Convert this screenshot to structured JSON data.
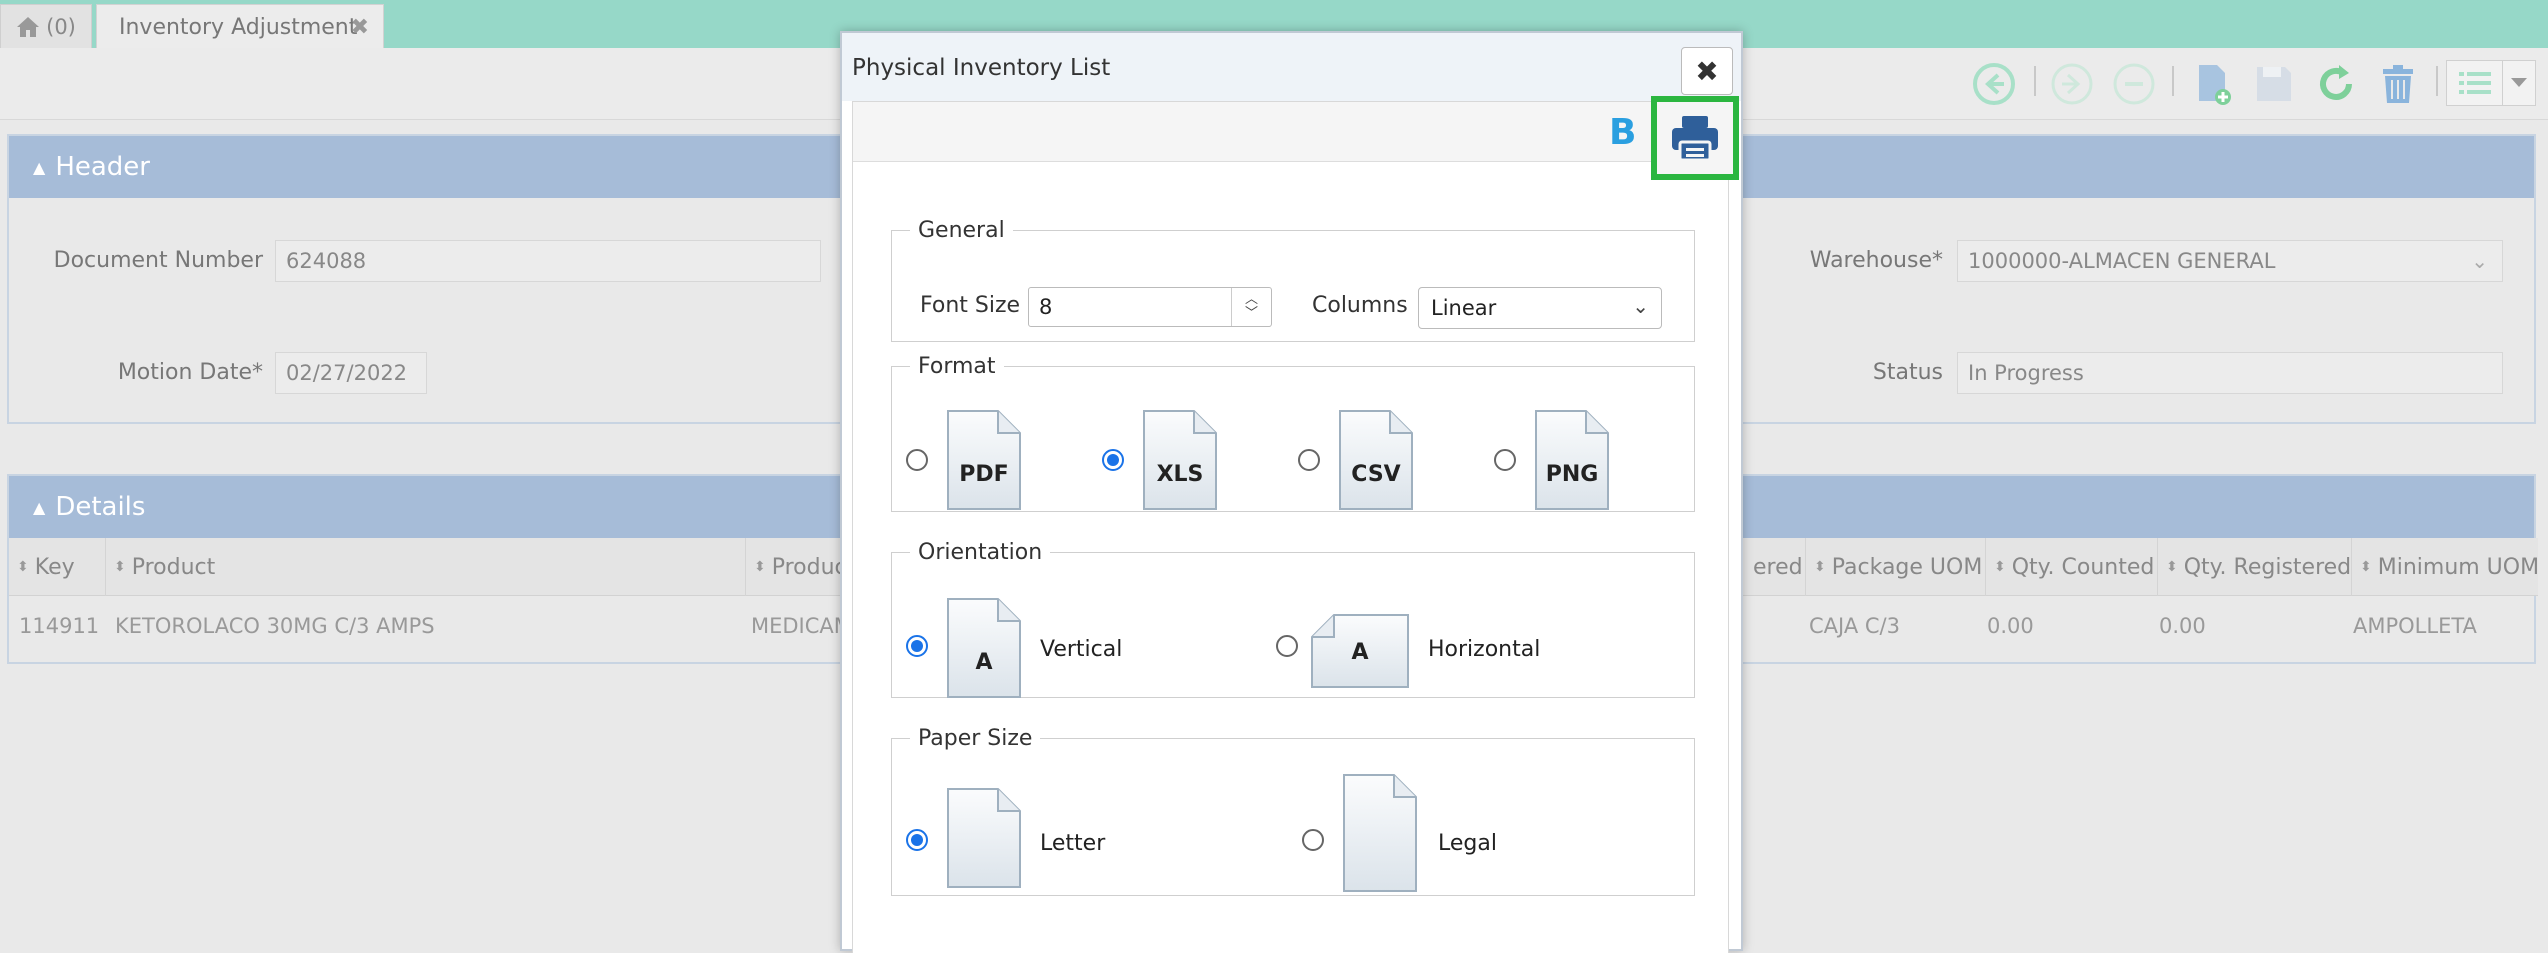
{
  "tabs": {
    "home_count": "(0)",
    "active_label": "Inventory Adjustment",
    "close_glyph": "✖"
  },
  "header_panel": {
    "title": "Header",
    "fields": {
      "document_number_label": "Document Number",
      "document_number_value": "624088",
      "motion_date_label": "Motion Date*",
      "motion_date_value": "02/27/2022",
      "warehouse_label": "Warehouse*",
      "warehouse_value": "1000000-ALMACEN GENERAL",
      "status_label": "Status",
      "status_value": "In Progress"
    }
  },
  "details_panel": {
    "title": "Details",
    "columns": [
      "Key",
      "Product",
      "Produc",
      "ered",
      "Package UOM",
      "Qty. Counted",
      "Qty. Registered",
      "Minimum UOM"
    ],
    "rows": [
      [
        "114911",
        "KETOROLACO 30MG C/3 AMPS",
        "MEDICAM",
        "",
        "CAJA C/3",
        "0.00",
        "0.00",
        "AMPOLLETA"
      ]
    ]
  },
  "toolbar_icons": [
    "back-arrow-icon",
    "forward-arrow-icon",
    "cancel-icon",
    "new-document-icon",
    "save-icon",
    "refresh-icon",
    "trash-icon",
    "list-icon",
    "chevron-down-icon"
  ],
  "modal": {
    "title": "Physical Inventory List",
    "close_glyph": "✖",
    "toolbar_b": "B",
    "general": {
      "legend": "General",
      "font_size_label": "Font Size",
      "font_size_value": "8",
      "columns_label": "Columns",
      "columns_value": "Linear"
    },
    "format": {
      "legend": "Format",
      "options": [
        "PDF",
        "XLS",
        "CSV",
        "PNG"
      ],
      "selected": "XLS"
    },
    "orientation": {
      "legend": "Orientation",
      "vertical_label": "Vertical",
      "horizontal_label": "Horizontal",
      "icon_letter": "A",
      "selected": "Vertical"
    },
    "paper_size": {
      "legend": "Paper Size",
      "letter_label": "Letter",
      "legal_label": "Legal",
      "selected": "Letter"
    }
  },
  "colors": {
    "tabbar": "#96d8c8",
    "panel_header": "#a6bcd8",
    "radio_selected": "#1a73e8",
    "highlight": "#2bb640",
    "print_icon": "#2f5f9a",
    "b_label": "#2a9fe0"
  }
}
